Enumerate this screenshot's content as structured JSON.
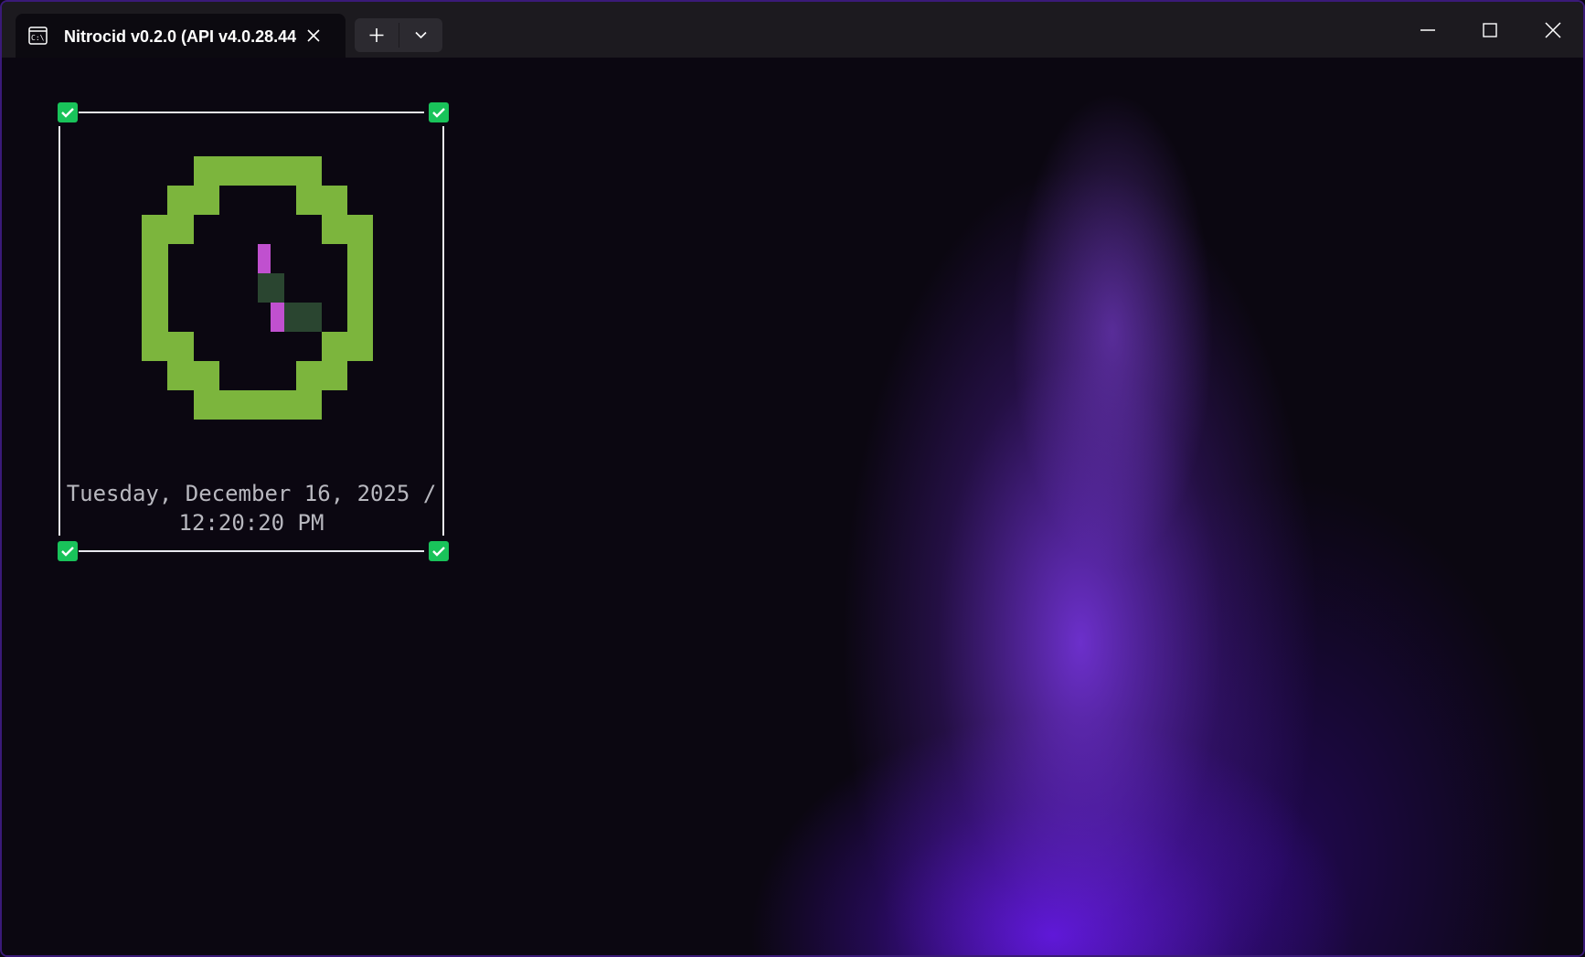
{
  "window": {
    "tab_title": "Nitrocid v0.2.0 (API v4.0.28.44",
    "tab_icon": "terminal-icon",
    "new_tab_icon": "plus-icon",
    "dropdown_icon": "chevron-down-icon",
    "minimize_icon": "minimize-icon",
    "maximize_icon": "maximize-icon",
    "close_icon": "close-icon"
  },
  "screensaver": {
    "date_line": "Tuesday, December 16, 2025 /",
    "time_line": "12:20:20 PM",
    "colors": {
      "clock_ring": "#7cb53d",
      "hand_accent": "#c050cf",
      "hand_dim": "#2a4530",
      "frame": "#e8e8ee",
      "corner_marker": "#19c35a",
      "text": "#b8b8bf"
    }
  }
}
